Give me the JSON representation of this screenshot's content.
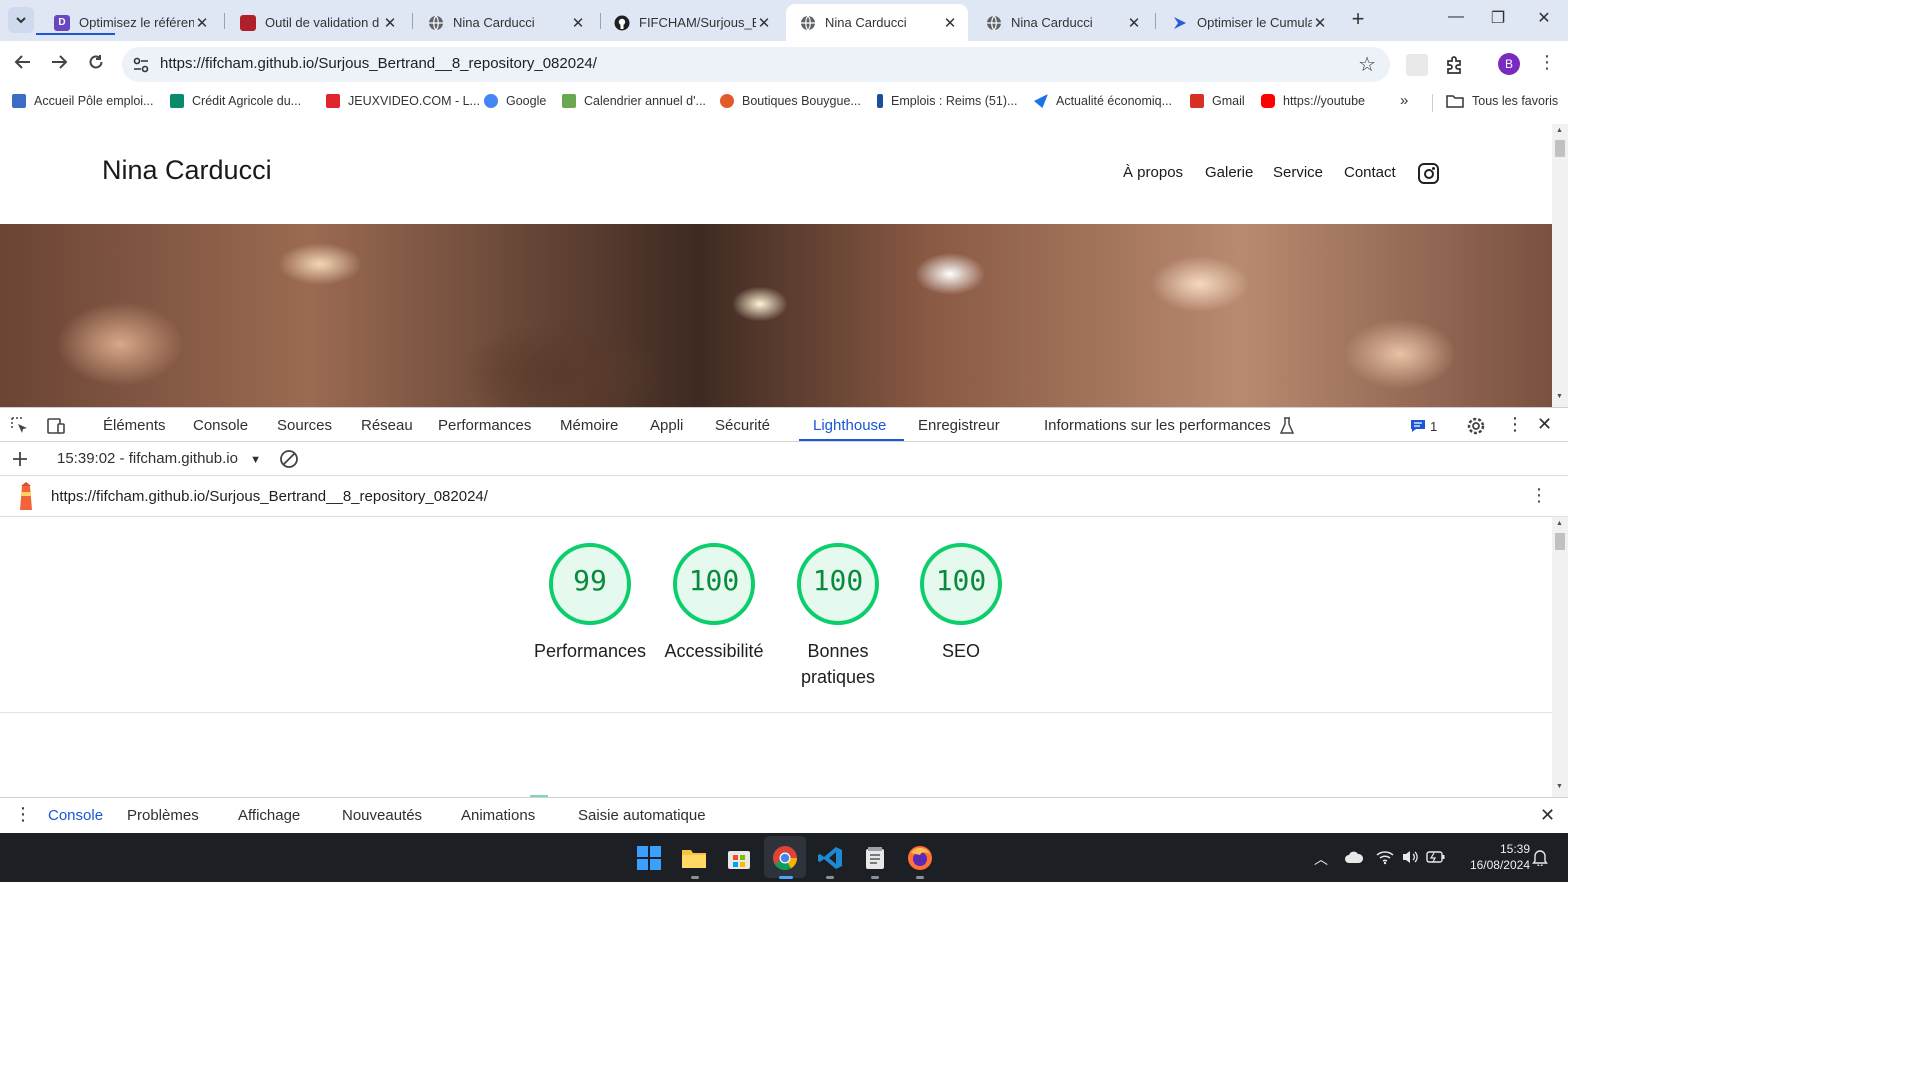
{
  "browser": {
    "tabs": [
      {
        "title": "Optimisez le référenc",
        "favicon_color": "#6b46c1"
      },
      {
        "title": "Outil de validation d",
        "favicon_color": "#b0202a"
      },
      {
        "title": "Nina Carducci",
        "favicon_color": "#5f6368"
      },
      {
        "title": "FIFCHAM/Surjous_Be",
        "favicon_color": "#1f1f1f"
      },
      {
        "title": "Nina Carducci",
        "favicon_color": "#5f6368"
      },
      {
        "title": "Nina Carducci",
        "favicon_color": "#5f6368"
      },
      {
        "title": "Optimiser le Cumula",
        "favicon_color": "#2b5bd7"
      }
    ],
    "active_tab_index": 4,
    "url": "https://fifcham.github.io/Surjous_Bertrand__8_repository_082024/",
    "profile_initial": "B",
    "bookmarks": [
      {
        "label": "Accueil Pôle emploi...",
        "color": "#3d6cc4"
      },
      {
        "label": "Crédit Agricole du...",
        "color": "#0a8a6a"
      },
      {
        "label": "JEUXVIDEO.COM - L...",
        "color": "#e0262c"
      },
      {
        "label": "Google",
        "color": "#4285f4"
      },
      {
        "label": "Calendrier annuel d'...",
        "color": "#6aa84f"
      },
      {
        "label": "Boutiques Bouygue...",
        "color": "#e35a2a"
      },
      {
        "label": "Emplois : Reims (51)...",
        "color": "#1a4fa0"
      },
      {
        "label": "Actualité économiq...",
        "color": "#1a73e8"
      },
      {
        "label": "Gmail",
        "color": "#d93025"
      },
      {
        "label": "https://youtube",
        "color": "#ff0000"
      }
    ],
    "bookmarks_more": "»",
    "all_bookmarks": "Tous les favoris"
  },
  "site": {
    "title": "Nina Carducci",
    "nav": [
      "À propos",
      "Galerie",
      "Service",
      "Contact"
    ]
  },
  "devtools": {
    "tabs": [
      "Éléments",
      "Console",
      "Sources",
      "Réseau",
      "Performances",
      "Mémoire",
      "Appli",
      "Sécurité",
      "Lighthouse",
      "Enregistreur",
      "Informations sur les performances"
    ],
    "active_tab": "Lighthouse",
    "issues_count": "1",
    "report_selector": "15:39:02 - fifcham.github.io",
    "report_url": "https://fifcham.github.io/Surjous_Bertrand__8_repository_082024/",
    "scores": [
      {
        "score": "99",
        "label": "Performances"
      },
      {
        "score": "100",
        "label": "Accessibilité"
      },
      {
        "score": "100",
        "label": "Bonnes pratiques"
      },
      {
        "score": "100",
        "label": "SEO"
      }
    ],
    "score_color": "#0cce6b",
    "drawer_tabs": [
      "Console",
      "Problèmes",
      "Affichage",
      "Nouveautés",
      "Animations",
      "Saisie automatique"
    ],
    "drawer_active": "Console"
  },
  "taskbar": {
    "time": "15:39",
    "date": "16/08/2024"
  }
}
